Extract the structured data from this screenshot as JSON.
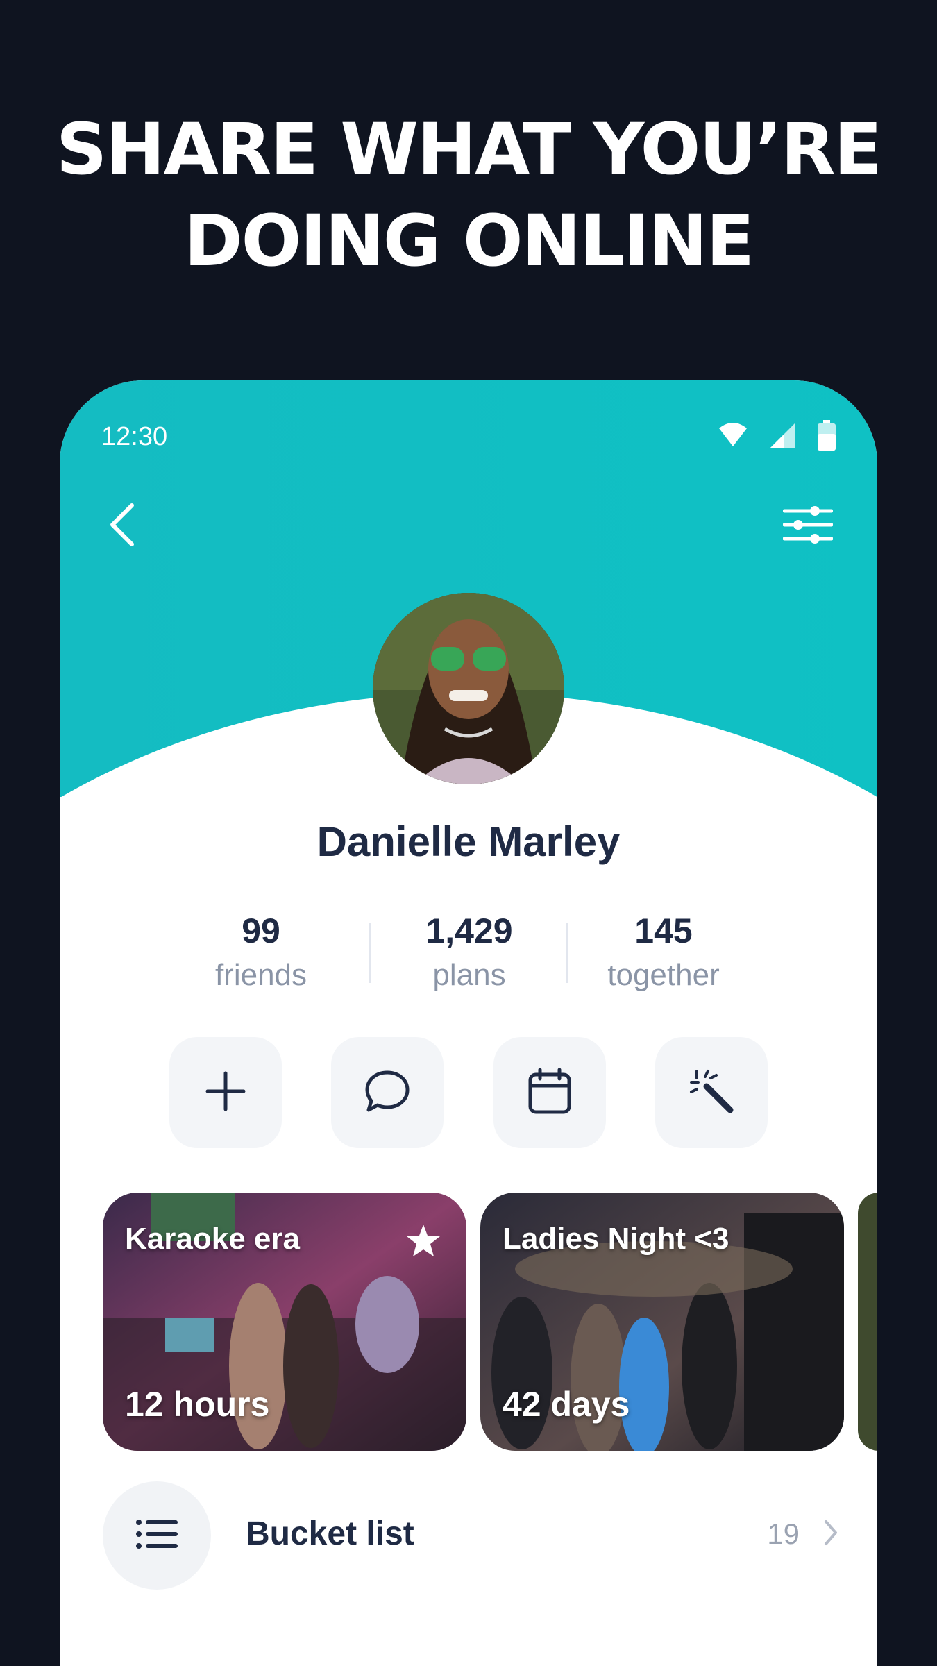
{
  "headline": {
    "line1": "SHARE WHAT YOU’RE",
    "line2": "DOING ONLINE"
  },
  "status_bar": {
    "time": "12:30",
    "icons": [
      "wifi-icon",
      "signal-icon",
      "battery-icon"
    ]
  },
  "toolbar": {
    "back_icon": "chevron-left-icon",
    "settings_icon": "sliders-icon"
  },
  "profile": {
    "name": "Danielle Marley",
    "accent": "#12bfc3"
  },
  "stats": [
    {
      "value": "99",
      "label": "friends"
    },
    {
      "value": "1,429",
      "label": "plans"
    },
    {
      "value": "145",
      "label": "together"
    }
  ],
  "actions": [
    {
      "icon": "plus-icon"
    },
    {
      "icon": "chat-bubble-icon"
    },
    {
      "icon": "calendar-icon"
    },
    {
      "icon": "magic-wand-icon"
    }
  ],
  "cards": [
    {
      "title": "Karaoke era",
      "duration": "12 hours",
      "starred": true
    },
    {
      "title": "Ladies Night <3",
      "duration": "42 days",
      "starred": false
    }
  ],
  "bucket_list": {
    "label": "Bucket list",
    "count": "19",
    "icon": "list-icon"
  }
}
